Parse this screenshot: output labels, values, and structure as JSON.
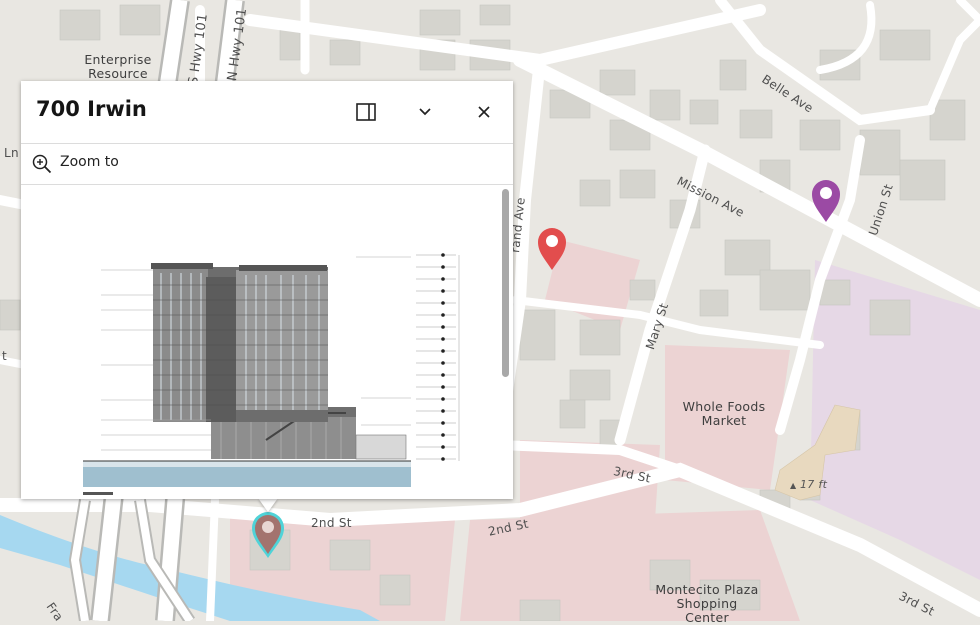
{
  "map": {
    "streets": {
      "mission_ave": "Mission Ave",
      "belle_ave": "Belle Ave",
      "union_st": "Union St",
      "mary_st": "Mary St",
      "grand_ave": "rand Ave",
      "third_st_1": "3rd St",
      "third_st_2": "3rd St",
      "second_st_1": "2nd St",
      "second_st_2": "2nd St",
      "hwy_101_a": "S Hwy 101",
      "hwy_101_b": "N Hwy 101",
      "ln_fragment": "Ln",
      "fra_fragment": "Fra",
      "t_fragment": "t"
    },
    "pois": {
      "enterprise": "Enterprise Resource",
      "whole_foods": "Whole Foods Market",
      "montecito": "Montecito Plaza Shopping Center"
    },
    "elevation": "17 ft",
    "colors": {
      "background": "#e9e7e2",
      "road": "#ffffff",
      "building": "#d5d4ce",
      "commercial": "#ecd3d3",
      "shopping": "#e6d8e6",
      "water": "#a6d8f0",
      "marker_red": "#e24d4d",
      "marker_purple": "#9b4aa4",
      "marker_selected": "#a3736e",
      "selection_halo": "#4fd3d8"
    }
  },
  "popup": {
    "title": "700 Irwin",
    "actions": {
      "dock_icon": "dock-icon",
      "collapse_icon": "chevron-down-icon",
      "close_icon": "close-icon"
    },
    "zoom_to": "Zoom to",
    "zoom_icon": "zoom-in-icon",
    "image_alt": "Building elevation drawing"
  }
}
